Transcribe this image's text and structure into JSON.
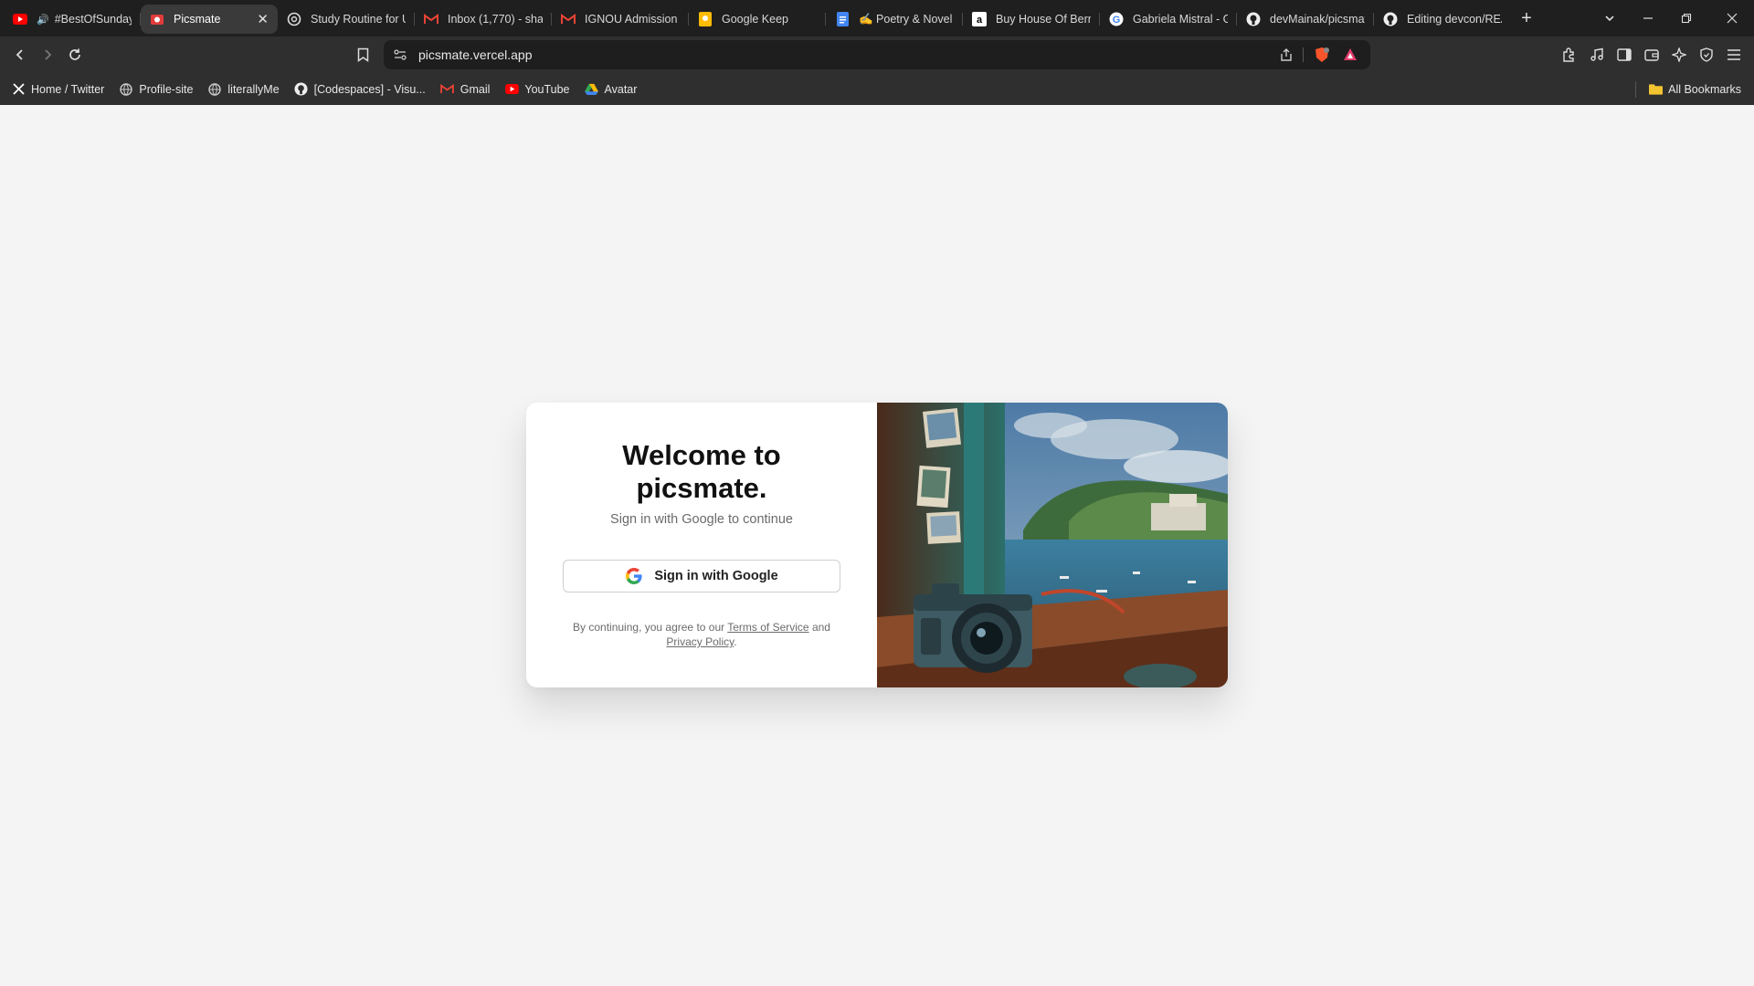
{
  "browser": {
    "tabs": [
      {
        "title": "#BestOfSunday",
        "favicon": "youtube-icon",
        "audio": true,
        "active": false
      },
      {
        "title": "Picsmate",
        "favicon": "picsmate-icon",
        "active": true
      },
      {
        "title": "Study Routine for U",
        "favicon": "openai-icon",
        "active": false
      },
      {
        "title": "Inbox (1,770) - sha",
        "favicon": "gmail-icon",
        "active": false
      },
      {
        "title": "IGNOU Admission (",
        "favicon": "gmail-icon",
        "active": false
      },
      {
        "title": "Google Keep",
        "favicon": "keep-icon",
        "active": false
      },
      {
        "title": "✍ Poetry & Novel",
        "favicon": "docs-icon",
        "active": false
      },
      {
        "title": "Buy House Of Bern",
        "favicon": "amazon-icon",
        "active": false
      },
      {
        "title": "Gabriela Mistral - G",
        "favicon": "google-icon",
        "active": false
      },
      {
        "title": "devMainak/picsmat",
        "favicon": "github-icon",
        "active": false
      },
      {
        "title": "Editing devcon/REA",
        "favicon": "github-icon",
        "active": false
      }
    ],
    "new_tab": "+",
    "address": "picsmate.vercel.app",
    "bookmarks": [
      {
        "label": "Home / Twitter",
        "icon": "x-icon"
      },
      {
        "label": "Profile-site",
        "icon": "globe-icon"
      },
      {
        "label": "literallyMe",
        "icon": "globe-icon"
      },
      {
        "label": "[Codespaces] - Visu...",
        "icon": "github-icon"
      },
      {
        "label": "Gmail",
        "icon": "gmail-icon"
      },
      {
        "label": "YouTube",
        "icon": "youtube-icon"
      },
      {
        "label": "Avatar",
        "icon": "drive-icon"
      }
    ],
    "all_bookmarks": "All Bookmarks"
  },
  "page": {
    "heading_line1": "Welcome to",
    "heading_line2": "picsmate.",
    "subtitle": "Sign in with Google to continue",
    "google_button": "Sign in with Google",
    "legal_prefix": "By continuing, you agree to our",
    "terms_link": "Terms of Service",
    "legal_and": "and",
    "privacy_link": "Privacy Policy",
    "legal_suffix": ".",
    "illustration": "camera-by-seaside-window-illustration"
  },
  "colors": {
    "tabstrip": "#1f1f1f",
    "toolbar": "#2f2f2f",
    "page_bg": "#f4f4f4",
    "card_bg": "#ffffff"
  }
}
